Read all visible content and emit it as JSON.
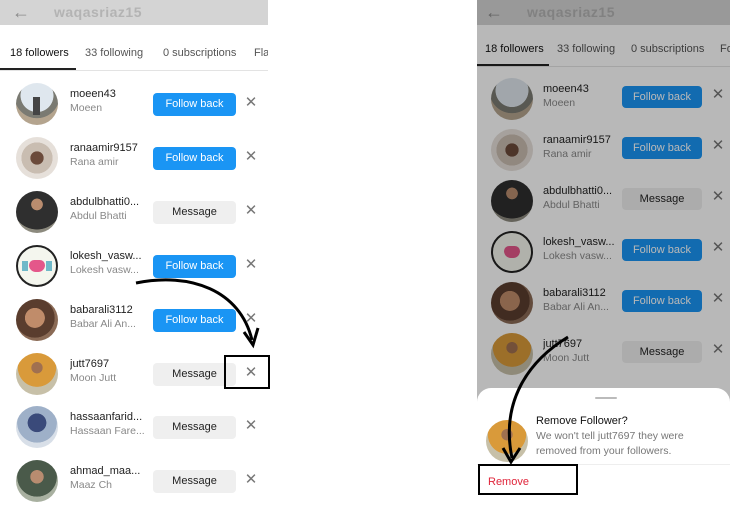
{
  "profile": {
    "username": "waqasriaz15",
    "back_icon": "back-arrow-icon"
  },
  "tabs": [
    {
      "label": "18 followers"
    },
    {
      "label": "33 following"
    },
    {
      "label": "0 subscriptions"
    },
    {
      "label": "Fla"
    }
  ],
  "followers": [
    {
      "handle": "moeen43",
      "name": "Moeen",
      "action": "Follow back"
    },
    {
      "handle": "ranaamir9157",
      "name": "Rana amir",
      "action": "Follow back"
    },
    {
      "handle": "abdulbhatti0...",
      "name": "Abdul Bhatti",
      "action": "Message"
    },
    {
      "handle": "lokesh_vasw...",
      "name": "Lokesh vasw...",
      "action": "Follow back"
    },
    {
      "handle": "babarali3112",
      "name": "Babar Ali An...",
      "action": "Follow back"
    },
    {
      "handle": "jutt7697",
      "name": "Moon Jutt",
      "action": "Message"
    },
    {
      "handle": "hassaanfarid...",
      "name": "Hassaan Fare...",
      "action": "Message"
    },
    {
      "handle": "ahmad_maa...",
      "name": "Maaz Ch",
      "action": "Message"
    }
  ],
  "right_tabs": [
    {
      "label": "18 followers"
    },
    {
      "label": "33 following"
    },
    {
      "label": "0 subscriptions"
    },
    {
      "label": "Fo"
    }
  ],
  "right_followers": [
    {
      "handle": "moeen43",
      "name": "Moeen",
      "action": "Follow back"
    },
    {
      "handle": "ranaamir9157",
      "name": "Rana amir",
      "action": "Follow back"
    },
    {
      "handle": "abdulbhatti0...",
      "name": "Abdul Bhatti",
      "action": "Message"
    },
    {
      "handle": "lokesh_vasw...",
      "name": "Lokesh vasw...",
      "action": "Follow back"
    },
    {
      "handle": "babarali3112",
      "name": "Babar Ali An...",
      "action": "Follow back"
    },
    {
      "handle": "jutt7697",
      "name": "Moon Jutt",
      "action": "Message"
    }
  ],
  "dialog": {
    "title": "Remove Follower?",
    "description": "We won't tell jutt7697 they were removed from your followers.",
    "remove_label": "Remove"
  },
  "colors": {
    "accent": "#1a95f4",
    "danger": "#e0243a",
    "secondary_button": "#efefef",
    "overlay": "rgba(0,0,0,0.28)"
  }
}
